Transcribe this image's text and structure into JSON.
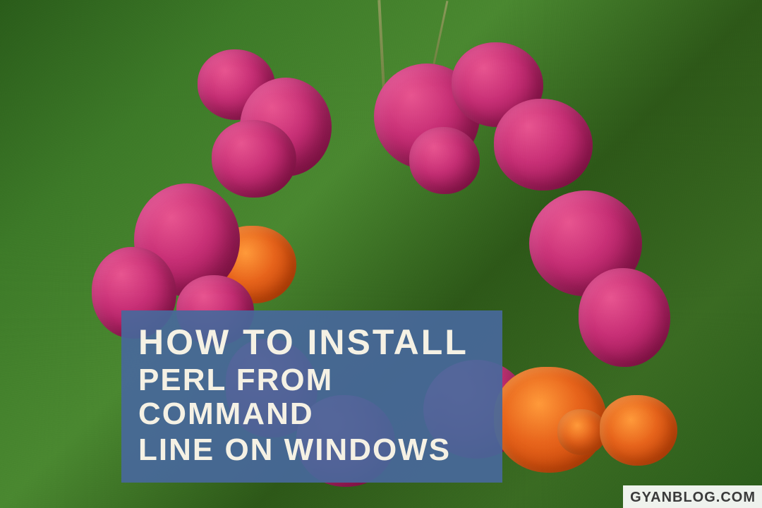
{
  "title_overlay": {
    "line1": "HOW TO INSTALL",
    "line2": "PERL FROM COMMAND",
    "line3": "LINE ON WINDOWS"
  },
  "watermark": {
    "text": "GYANBLOG.COM"
  },
  "colors": {
    "overlay_bg": "#48689b",
    "overlay_text": "#f5f1e4",
    "watermark_bg": "#ffffff",
    "watermark_text": "#3a3a3a"
  }
}
